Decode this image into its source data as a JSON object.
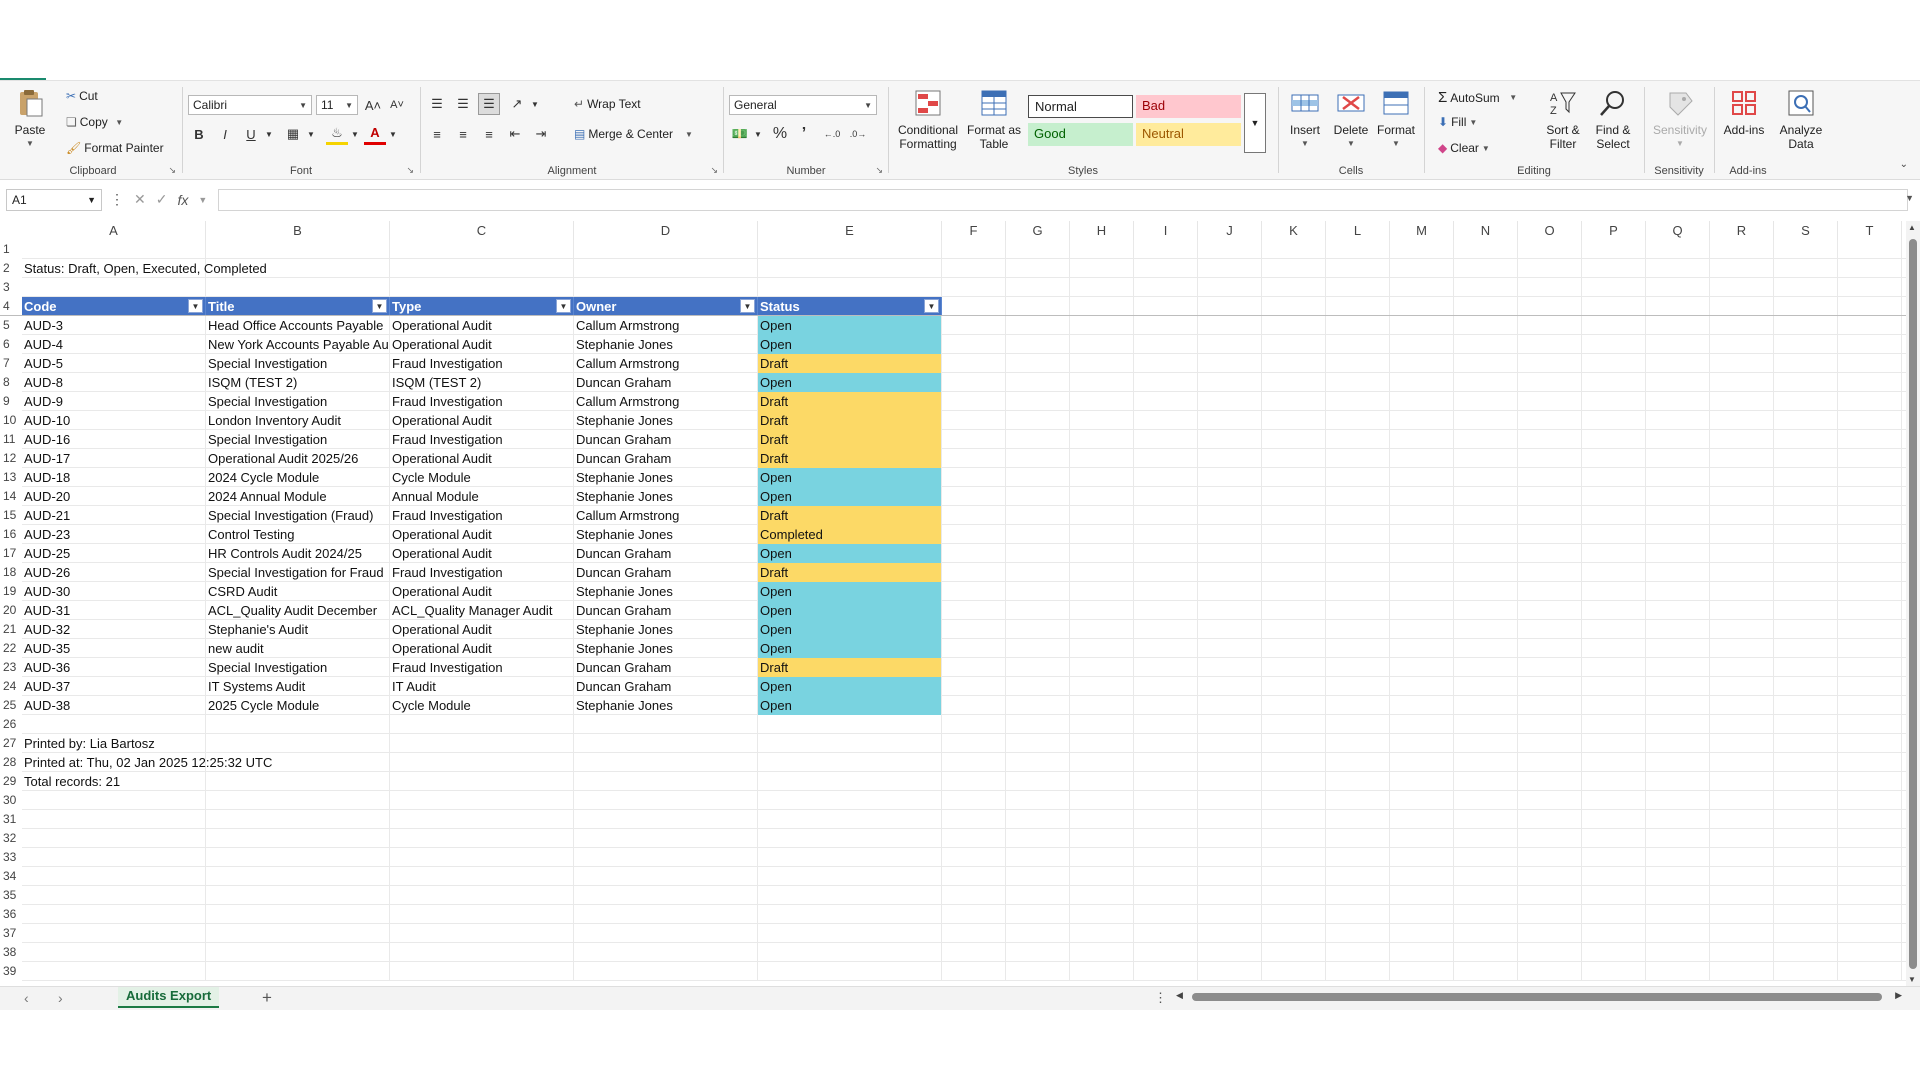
{
  "ribbon": {
    "clipboard": {
      "label": "Clipboard",
      "paste": "Paste",
      "cut": "Cut",
      "copy": "Copy",
      "format_painter": "Format Painter"
    },
    "font": {
      "label": "Font",
      "name": "Calibri",
      "size": "11",
      "bold": "B",
      "italic": "I",
      "underline": "U",
      "grow": "A˄",
      "shrink": "A˅",
      "font_color": "A"
    },
    "alignment": {
      "label": "Alignment",
      "wrap_text": "Wrap Text",
      "merge_center": "Merge & Center"
    },
    "number": {
      "label": "Number",
      "format": "General",
      "percent": "%",
      "comma": "’"
    },
    "styles": {
      "label": "Styles",
      "conditional": "Conditional Formatting",
      "format_table": "Format as Table",
      "normal": "Normal",
      "bad": "Bad",
      "good": "Good",
      "neutral": "Neutral"
    },
    "cells": {
      "label": "Cells",
      "insert": "Insert",
      "delete": "Delete",
      "format": "Format"
    },
    "editing": {
      "label": "Editing",
      "autosum": "AutoSum",
      "fill": "Fill",
      "clear": "Clear",
      "sort_filter": "Sort & Filter",
      "find_select": "Find & Select"
    },
    "sensitivity": {
      "label": "Sensitivity",
      "button": "Sensitivity"
    },
    "addins": {
      "label": "Add-ins",
      "button": "Add-ins",
      "analyze": "Analyze Data"
    }
  },
  "formula_bar": {
    "name_box": "A1",
    "fx": "fx",
    "value": ""
  },
  "columns": [
    "A",
    "B",
    "C",
    "D",
    "E",
    "F",
    "G",
    "H",
    "I",
    "J",
    "K",
    "L",
    "M",
    "N",
    "O",
    "P",
    "Q",
    "R",
    "S",
    "T"
  ],
  "rows": [
    "1",
    "2",
    "3",
    "4",
    "5",
    "6",
    "7",
    "8",
    "9",
    "10",
    "11",
    "12",
    "13",
    "14",
    "15",
    "16",
    "17",
    "18",
    "19",
    "20",
    "21",
    "22",
    "23",
    "24",
    "25",
    "26",
    "27",
    "28",
    "29",
    "30",
    "31",
    "32",
    "33",
    "34",
    "35",
    "36",
    "37",
    "38",
    "39"
  ],
  "sheet": {
    "status_note": "Status: Draft, Open, Executed, Completed",
    "headers": [
      "Code",
      "Title",
      "Type",
      "Owner",
      "Status"
    ],
    "records": [
      [
        "AUD-3",
        "Head Office Accounts Payable",
        "Operational Audit",
        "Callum Armstrong",
        "Open"
      ],
      [
        "AUD-4",
        "New York Accounts Payable Audit",
        "Operational Audit",
        "Stephanie Jones",
        "Open"
      ],
      [
        "AUD-5",
        "Special Investigation",
        "Fraud Investigation",
        "Callum Armstrong",
        "Draft"
      ],
      [
        "AUD-8",
        "ISQM (TEST 2)",
        "ISQM (TEST 2)",
        "Duncan Graham",
        "Open"
      ],
      [
        "AUD-9",
        "Special Investigation",
        "Fraud Investigation",
        "Callum Armstrong",
        "Draft"
      ],
      [
        "AUD-10",
        "London Inventory Audit",
        "Operational Audit",
        "Stephanie Jones",
        "Draft"
      ],
      [
        "AUD-16",
        "Special Investigation",
        "Fraud Investigation",
        "Duncan Graham",
        "Draft"
      ],
      [
        "AUD-17",
        "Operational Audit 2025/26",
        "Operational Audit",
        "Duncan Graham",
        "Draft"
      ],
      [
        "AUD-18",
        "2024 Cycle Module",
        "Cycle Module",
        "Stephanie Jones",
        "Open"
      ],
      [
        "AUD-20",
        "2024 Annual Module",
        "Annual Module",
        "Stephanie Jones",
        "Open"
      ],
      [
        "AUD-21",
        "Special Investigation (Fraud)",
        "Fraud Investigation",
        "Callum Armstrong",
        "Draft"
      ],
      [
        "AUD-23",
        "Control Testing",
        "Operational Audit",
        "Stephanie Jones",
        "Completed"
      ],
      [
        "AUD-25",
        "HR Controls Audit 2024/25",
        "Operational Audit",
        "Duncan Graham",
        "Open"
      ],
      [
        "AUD-26",
        "Special Investigation for Fraud",
        "Fraud Investigation",
        "Duncan Graham",
        "Draft"
      ],
      [
        "AUD-30",
        "CSRD Audit",
        "Operational Audit",
        "Stephanie Jones",
        "Open"
      ],
      [
        "AUD-31",
        "ACL_Quality Audit December",
        "ACL_Quality Manager Audit",
        "Duncan Graham",
        "Open"
      ],
      [
        "AUD-32",
        "Stephanie's Audit",
        "Operational Audit",
        "Stephanie Jones",
        "Open"
      ],
      [
        "AUD-35",
        "new audit",
        "Operational Audit",
        "Stephanie Jones",
        "Open"
      ],
      [
        "AUD-36",
        "Special Investigation",
        "Fraud Investigation",
        "Duncan Graham",
        "Draft"
      ],
      [
        "AUD-37",
        "IT Systems Audit",
        "IT Audit",
        "Duncan Graham",
        "Open"
      ],
      [
        "AUD-38",
        "2025 Cycle Module",
        "Cycle Module",
        "Stephanie Jones",
        "Open"
      ]
    ],
    "printed_by": "Printed by: Lia Bartosz",
    "printed_at": "Printed at: Thu, 02 Jan 2025 12:25:32 UTC",
    "total_records": "Total records: 21"
  },
  "status_colors": {
    "Open": "#79d3e0",
    "Draft": "#fcd966",
    "Completed": "#fcd966"
  },
  "tabs": {
    "active": "Audits Export",
    "add": "+"
  }
}
